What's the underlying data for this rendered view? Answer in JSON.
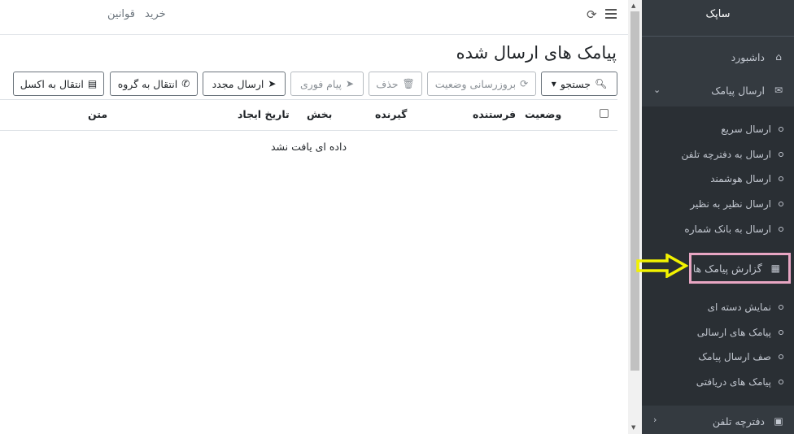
{
  "topbar": {
    "buy_link": "خرید",
    "rules_link": "قوانین",
    "menu_icon": "menu-icon",
    "refresh_icon": "refresh-icon"
  },
  "page": {
    "title": "پیامک های ارسال شده"
  },
  "toolbar": {
    "search": "جستجو",
    "refresh_status": "بروزرسانی وضعیت",
    "delete": "حذف",
    "instant_message": "پیام فوری",
    "resend": "ارسال مجدد",
    "to_group": "انتقال به گروه",
    "to_excel": "انتقال به اکسل"
  },
  "table": {
    "columns": {
      "status": "وضعیت",
      "sender": "فرستنده",
      "receiver": "گیرنده",
      "section": "بخش",
      "created_at": "تاریخ ایجاد",
      "text": "متن"
    },
    "empty_text": "داده ای یافت نشد"
  },
  "sidebar": {
    "brand": "ساپک",
    "dashboard": "داشبورد",
    "send_sms": "ارسال پیامک",
    "send_items": [
      "ارسال سریع",
      "ارسال به دفترچه تلفن",
      "ارسال هوشمند",
      "ارسال نظیر به نظیر",
      "ارسال به بانک شماره"
    ],
    "reports": "گزارش پیامک ها",
    "report_items": [
      "نمایش دسته ای",
      "پیامک های ارسالی",
      "صف ارسال پیامک",
      "پیامک های دریافتی"
    ],
    "phonebook": "دفترچه تلفن"
  },
  "colors": {
    "sidebar_bg": "#343a40",
    "submenu_bg": "#2a2f34",
    "highlight_border": "#e8a6c3",
    "annotation_arrow": "#ffff00"
  }
}
